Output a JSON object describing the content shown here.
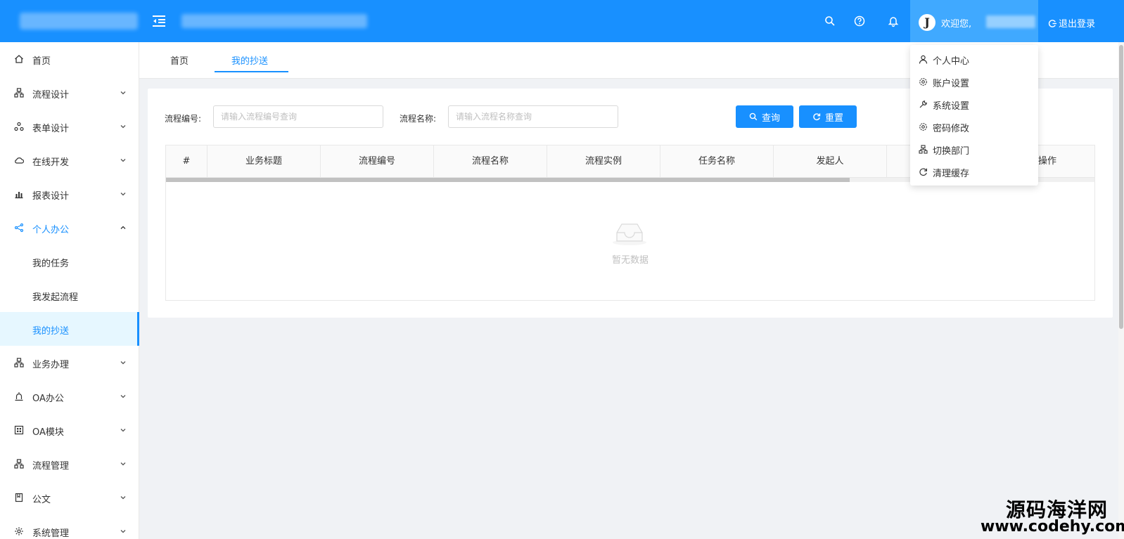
{
  "header": {
    "welcome": "欢迎您,",
    "logout": "退出登录",
    "user_initial": "J",
    "icons": [
      "search-icon",
      "help-icon",
      "bell-icon"
    ]
  },
  "sidebar": {
    "items": [
      {
        "label": "首页",
        "icon": "home-icon"
      },
      {
        "label": "流程设计",
        "icon": "flow-icon"
      },
      {
        "label": "表单设计",
        "icon": "form-icon"
      },
      {
        "label": "在线开发",
        "icon": "cloud-icon"
      },
      {
        "label": "报表设计",
        "icon": "chart-icon"
      },
      {
        "label": "个人办公",
        "icon": "share-icon"
      },
      {
        "label": "我的任务"
      },
      {
        "label": "我发起流程"
      },
      {
        "label": "我的抄送"
      },
      {
        "label": "业务办理",
        "icon": "flow-icon"
      },
      {
        "label": "OA办公",
        "icon": "alarm-icon"
      },
      {
        "label": "OA模块",
        "icon": "grid-icon"
      },
      {
        "label": "流程管理",
        "icon": "flow-icon"
      },
      {
        "label": "公文",
        "icon": "doc-icon"
      },
      {
        "label": "系统管理",
        "icon": "gear-icon"
      }
    ]
  },
  "tabs": [
    {
      "label": "首页"
    },
    {
      "label": "我的抄送"
    }
  ],
  "filters": {
    "process_no_label": "流程编号:",
    "process_no_placeholder": "请输入流程编号查询",
    "process_name_label": "流程名称:",
    "process_name_placeholder": "请输入流程名称查询",
    "search_button": "查询",
    "reset_button": "重置"
  },
  "table": {
    "columns": [
      "#",
      "业务标题",
      "流程编号",
      "流程名称",
      "流程实例",
      "任务名称",
      "发起人",
      "操作"
    ],
    "empty_text": "暂无数据"
  },
  "user_menu": {
    "items": [
      {
        "label": "个人中心",
        "icon": "user-icon"
      },
      {
        "label": "账户设置",
        "icon": "settings-icon"
      },
      {
        "label": "系统设置",
        "icon": "wrench-icon"
      },
      {
        "label": "密码修改",
        "icon": "gear-icon"
      },
      {
        "label": "切换部门",
        "icon": "flow-icon"
      },
      {
        "label": "清理缓存",
        "icon": "refresh-icon"
      }
    ]
  },
  "watermark": {
    "cn": "源码海洋网",
    "en": "www.codehy.com"
  },
  "colors": {
    "primary": "#1890ff",
    "header_bg": "#1890ff",
    "active_bg": "#e6f7ff"
  }
}
